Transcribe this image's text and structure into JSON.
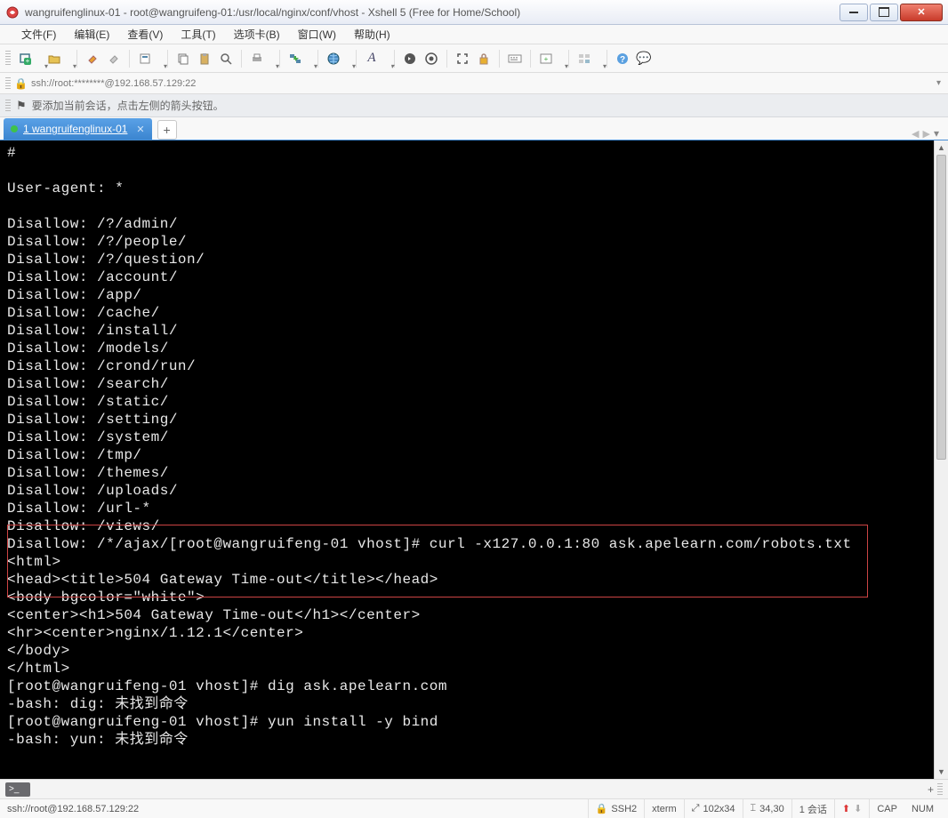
{
  "window": {
    "title": "wangruifenglinux-01 - root@wangruifeng-01:/usr/local/nginx/conf/vhost - Xshell 5 (Free for Home/School)"
  },
  "menu": {
    "file": "文件(F)",
    "edit": "编辑(E)",
    "view": "查看(V)",
    "tools": "工具(T)",
    "options": "选项卡(B)",
    "window": "窗口(W)",
    "help": "帮助(H)"
  },
  "address": {
    "text": "ssh://root:********@192.168.57.129:22"
  },
  "tip": {
    "text": "要添加当前会话，点击左侧的箭头按钮。"
  },
  "tab": {
    "label": "1 wangruifenglinux-01"
  },
  "terminal": {
    "content": "#\n\nUser-agent: *\n\nDisallow: /?/admin/\nDisallow: /?/people/\nDisallow: /?/question/\nDisallow: /account/\nDisallow: /app/\nDisallow: /cache/\nDisallow: /install/\nDisallow: /models/\nDisallow: /crond/run/\nDisallow: /search/\nDisallow: /static/\nDisallow: /setting/\nDisallow: /system/\nDisallow: /tmp/\nDisallow: /themes/\nDisallow: /uploads/\nDisallow: /url-*\nDisallow: /views/\nDisallow: /*/ajax/[root@wangruifeng-01 vhost]# curl -x127.0.0.1:80 ask.apelearn.com/robots.txt\n<html>\n<head><title>504 Gateway Time-out</title></head>\n<body bgcolor=\"white\">\n<center><h1>504 Gateway Time-out</h1></center>\n<hr><center>nginx/1.12.1</center>\n</body>\n</html>\n[root@wangruifeng-01 vhost]# dig ask.apelearn.com\n-bash: dig: 未找到命令\n[root@wangruifeng-01 vhost]# yun install -y bind\n-bash: yun: 未找到命令"
  },
  "status": {
    "conn": "ssh://root@192.168.57.129:22",
    "proto": "SSH2",
    "term": "xterm",
    "size": "102x34",
    "cursor": "34,30",
    "sessions": "1 会话",
    "cap": "CAP",
    "num": "NUM"
  },
  "icons": {
    "lock": "🔒",
    "flag": "⚑",
    "add": "➕"
  }
}
